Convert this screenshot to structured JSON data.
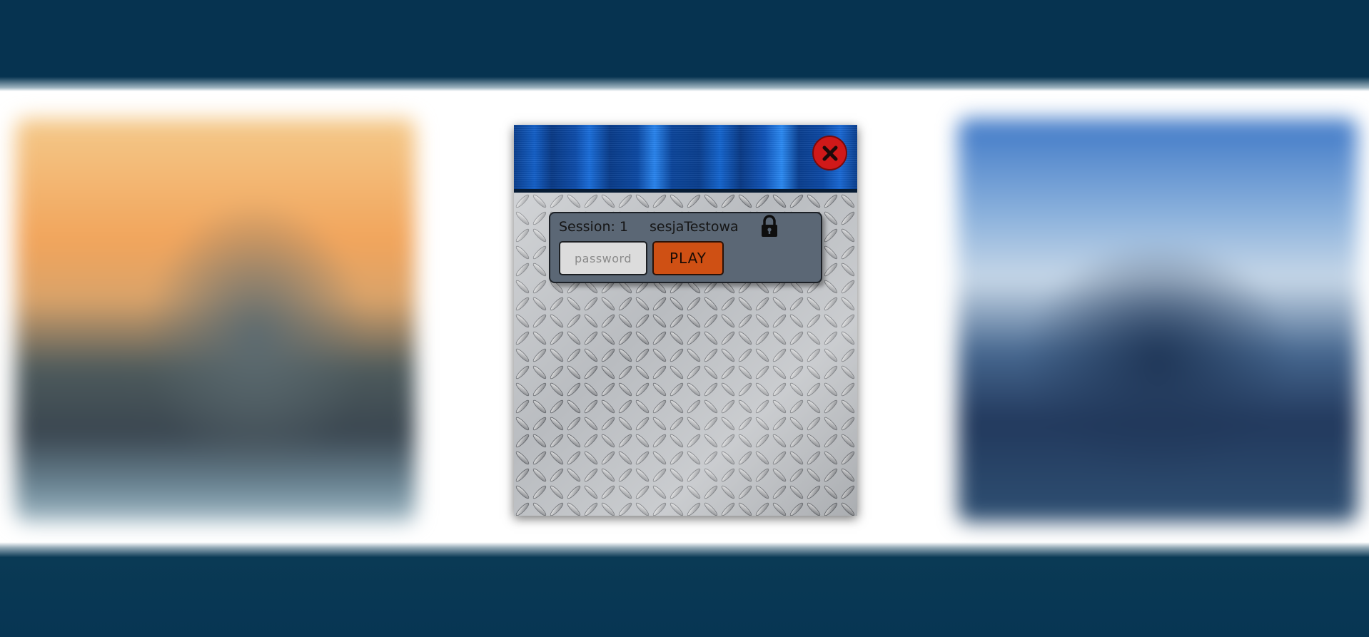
{
  "modal": {
    "close_icon": "close-icon",
    "session": {
      "label": "Session: 1",
      "name": "sesjaTestowa",
      "lock_icon": "lock-icon",
      "password": {
        "placeholder": "password",
        "value": ""
      },
      "play_label": "PLAY"
    }
  },
  "colors": {
    "background_band": "#063350",
    "header_blue": "#1460c8",
    "close_red": "#d01919",
    "panel": "#5b6775",
    "play_orange": "#cf5014",
    "input_bg": "#dcdcdc"
  }
}
